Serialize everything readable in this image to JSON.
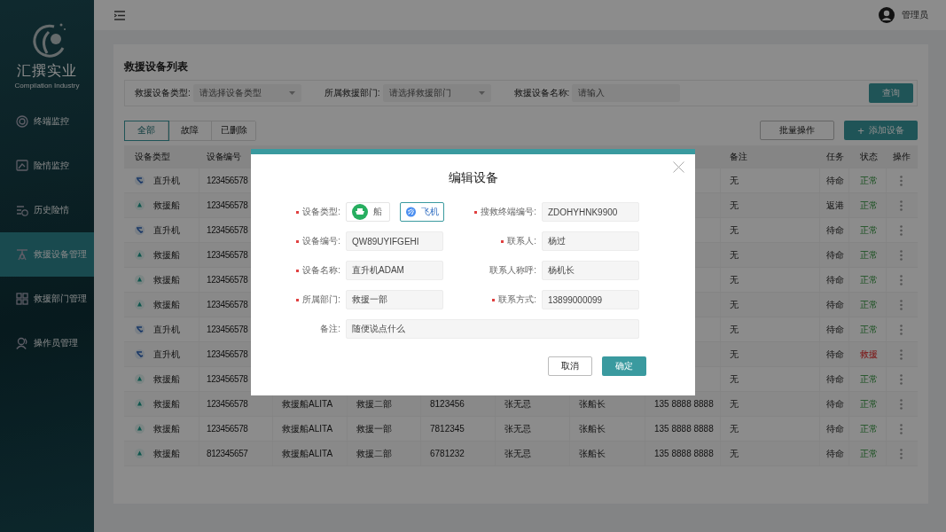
{
  "sidebar": {
    "brand": "汇撰实业",
    "brand_sub": "Compilation Industry",
    "items": [
      {
        "label": "终端监控",
        "selected": false
      },
      {
        "label": "险情监控",
        "selected": false
      },
      {
        "label": "历史险情",
        "selected": false
      },
      {
        "label": "救援设备管理",
        "selected": true
      },
      {
        "label": "救援部门管理",
        "selected": false
      },
      {
        "label": "操作员管理",
        "selected": false
      }
    ]
  },
  "header": {
    "user": "管理员"
  },
  "page": {
    "title": "救援设备列表",
    "filters": [
      {
        "label": "救援设备类型:",
        "placeholder": "请选择设备类型",
        "kind": "select"
      },
      {
        "label": "所属救援部门:",
        "placeholder": "请选择救援部门",
        "kind": "select"
      },
      {
        "label": "救援设备名称:",
        "placeholder": "请输入",
        "kind": "input"
      }
    ],
    "search_button": "查询",
    "tabs": [
      {
        "label": "全部",
        "selected": true
      },
      {
        "label": "故障",
        "selected": false
      },
      {
        "label": "已删除",
        "selected": false
      }
    ],
    "batch_button": "批量操作",
    "add_button": "添加设备",
    "add_icon": "+"
  },
  "table": {
    "columns": {
      "type": "设备类型",
      "id": "设备编号",
      "note": "备注",
      "task": "任务",
      "status": "状态",
      "action": "操作"
    },
    "rows": [
      {
        "kind": "heli",
        "type": "直升机",
        "id": "123456578",
        "note": "无",
        "task": "待命",
        "status": "正常",
        "alert": false
      },
      {
        "kind": "boat",
        "type": "救援船",
        "id": "123456578",
        "note": "无",
        "task": "返港",
        "status": "正常",
        "alert": false
      },
      {
        "kind": "heli",
        "type": "直升机",
        "id": "123456578",
        "note": "无",
        "task": "待命",
        "status": "正常",
        "alert": false
      },
      {
        "kind": "boat",
        "type": "救援船",
        "id": "123456578",
        "note": "无",
        "task": "待命",
        "status": "正常",
        "alert": false
      },
      {
        "kind": "boat",
        "type": "救援船",
        "id": "123456578",
        "note": "无",
        "task": "待命",
        "status": "正常",
        "alert": false
      },
      {
        "kind": "boat",
        "type": "救援船",
        "id": "123456578",
        "note": "无",
        "task": "待命",
        "status": "正常",
        "alert": false
      },
      {
        "kind": "heli",
        "type": "直升机",
        "id": "123456578",
        "note": "无",
        "task": "待命",
        "status": "正常",
        "alert": false
      },
      {
        "kind": "heli",
        "type": "直升机",
        "id": "123456578",
        "note": "无",
        "task": "待命",
        "status": "救援",
        "alert": true
      },
      {
        "kind": "boat",
        "type": "救援船",
        "id": "123456578",
        "note": "无",
        "task": "待命",
        "status": "正常",
        "alert": false
      },
      {
        "kind": "boat",
        "type": "救援船",
        "id": "123456578",
        "name": "救援船ALITA",
        "dept": "救援二部",
        "code": "8123456",
        "contact": "张无忌",
        "title": "张船长",
        "phone": "135 8888 8888",
        "note": "无",
        "task": "待命",
        "status": "正常",
        "alert": false
      },
      {
        "kind": "boat",
        "type": "救援船",
        "id": "123456578",
        "name": "救援船ALITA",
        "dept": "救援一部",
        "code": "7812345",
        "contact": "张无忌",
        "title": "张船长",
        "phone": "135 8888 8888",
        "note": "无",
        "task": "待命",
        "status": "正常",
        "alert": false
      },
      {
        "kind": "boat",
        "type": "救援船",
        "id": "812345657",
        "name": "救援船ALITA",
        "dept": "救援二部",
        "code": "6781232",
        "contact": "张无忌",
        "title": "张船长",
        "phone": "135 8888 8888",
        "note": "无",
        "task": "待命",
        "status": "正常",
        "alert": false
      }
    ]
  },
  "dialog": {
    "title": "编辑设备",
    "fields": [
      {
        "kind": "choice",
        "label": "设备类型:",
        "required": true,
        "options": [
          {
            "label": "船",
            "kind": "boat",
            "selected": false
          },
          {
            "label": "飞机",
            "kind": "plane",
            "selected": true
          }
        ]
      },
      {
        "kind": "text",
        "label": "搜救终端编号:",
        "required": true,
        "value": "ZDOHYHNK9900"
      },
      {
        "kind": "text",
        "label": "设备编号:",
        "required": true,
        "value": "QW89UYIFGEHI"
      },
      {
        "kind": "text",
        "label": "联系人:",
        "required": true,
        "value": "杨过"
      },
      {
        "kind": "text",
        "label": "设备名称:",
        "required": true,
        "value": "直升机ADAM"
      },
      {
        "kind": "text",
        "label": "联系人称呼:",
        "required": false,
        "value": "杨机长"
      },
      {
        "kind": "text",
        "label": "所属部门:",
        "required": true,
        "value": "救援一部"
      },
      {
        "kind": "text",
        "label": "联系方式:",
        "required": true,
        "value": "13899000099"
      },
      {
        "kind": "wide",
        "label": "备注:",
        "required": false,
        "value": "随便说点什么"
      }
    ],
    "cancel": "取消",
    "ok": "确定"
  }
}
